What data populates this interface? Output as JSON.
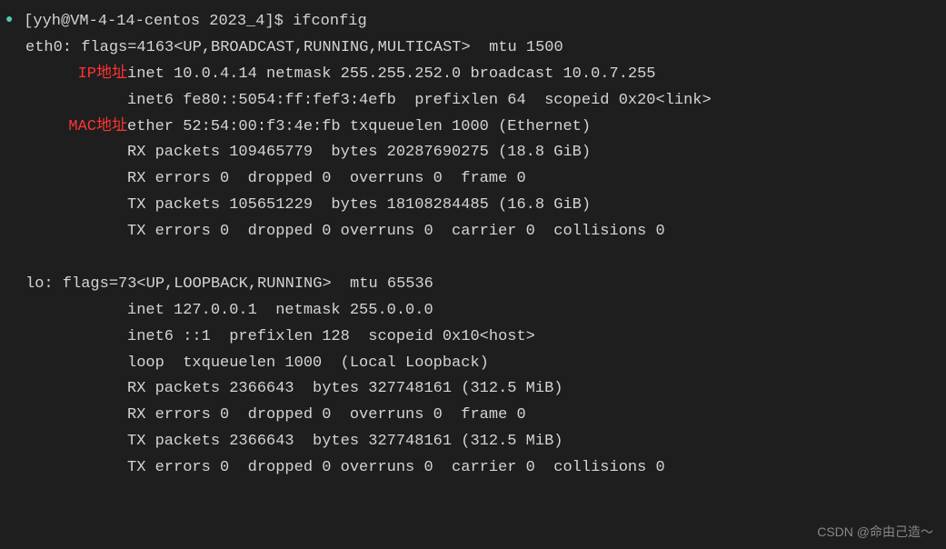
{
  "prompt": {
    "text": "[yyh@VM-4-14-centos 2023_4]$ ",
    "command": "ifconfig"
  },
  "labels": {
    "ip": "IP地址",
    "mac": "MAC地址"
  },
  "eth0": {
    "header": "eth0: flags=4163<UP,BROADCAST,RUNNING,MULTICAST>  mtu 1500",
    "inet": "inet 10.0.4.14  netmask 255.255.252.0  broadcast 10.0.7.255",
    "inet6": "inet6 fe80::5054:ff:fef3:4efb  prefixlen 64  scopeid 0x20<link>",
    "ether": "ether 52:54:00:f3:4e:fb  txqueuelen 1000  (Ethernet)",
    "rx_packets": "RX packets 109465779  bytes 20287690275 (18.8 GiB)",
    "rx_errors": "RX errors 0  dropped 0  overruns 0  frame 0",
    "tx_packets": "TX packets 105651229  bytes 18108284485 (16.8 GiB)",
    "tx_errors": "TX errors 0  dropped 0 overruns 0  carrier 0  collisions 0"
  },
  "lo": {
    "header": "lo: flags=73<UP,LOOPBACK,RUNNING>  mtu 65536",
    "inet": "inet 127.0.0.1  netmask 255.0.0.0",
    "inet6": "inet6 ::1  prefixlen 128  scopeid 0x10<host>",
    "loop": "loop  txqueuelen 1000  (Local Loopback)",
    "rx_packets": "RX packets 2366643  bytes 327748161 (312.5 MiB)",
    "rx_errors": "RX errors 0  dropped 0  overruns 0  frame 0",
    "tx_packets": "TX packets 2366643  bytes 327748161 (312.5 MiB)",
    "tx_errors": "TX errors 0  dropped 0 overruns 0  carrier 0  collisions 0"
  },
  "watermark": "CSDN @命由己造～"
}
